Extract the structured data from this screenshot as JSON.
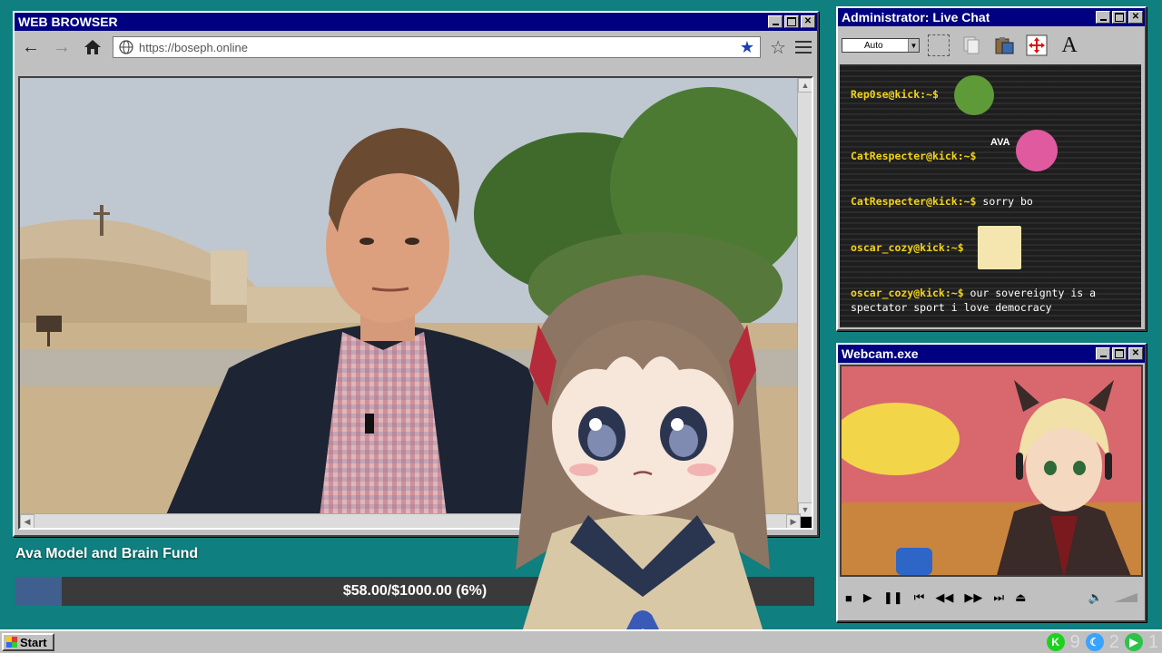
{
  "browser": {
    "title": "WEB BROWSER",
    "url": "https://boseph.online",
    "nav": {
      "back": "←",
      "forward": "→",
      "home": "⌂"
    }
  },
  "fund": {
    "title": "Ava Model and Brain Fund",
    "progress_text": "$58.00/$1000.00 (6%)",
    "raised": 58.0,
    "goal": 1000.0,
    "percent": 6
  },
  "chat": {
    "title": "Administrator: Live Chat",
    "font_select": "Auto",
    "tool_text_icon": "A",
    "messages": [
      {
        "user": "Rep0se@kick:~$",
        "text": "",
        "emote": "screaming-frog"
      },
      {
        "user": "CatRespecter@kick:~$",
        "text": "",
        "emote": "ava-donut-frog",
        "emote_label": "AVA"
      },
      {
        "user": "CatRespecter@kick:~$",
        "text": "sorry bo"
      },
      {
        "user": "oscar_cozy@kick:~$",
        "text": "",
        "emote": "anime-girl"
      },
      {
        "user": "oscar_cozy@kick:~$",
        "text": "our sovereignty is a"
      },
      {
        "user": "",
        "text": "spectator sport i love democracy"
      }
    ]
  },
  "webcam": {
    "title": "Webcam.exe",
    "controls": [
      "■",
      "▶",
      "❚❚",
      "⏮",
      "◀◀",
      "▶▶",
      "⏭",
      "⏏",
      "🔈"
    ]
  },
  "taskbar": {
    "start": "Start",
    "tray": [
      {
        "icon": "kick-icon",
        "count": "9",
        "color": "#1fd11f"
      },
      {
        "icon": "moon-icon",
        "count": "2",
        "color": "#3aa3ff"
      },
      {
        "icon": "play-icon",
        "count": "1",
        "color": "#2ec24a"
      }
    ]
  },
  "colors": {
    "desktop": "#0f7f7f",
    "titlebar": "#000080",
    "chat_username": "#f2d31b",
    "fund_fill": "#3f5f8e"
  }
}
